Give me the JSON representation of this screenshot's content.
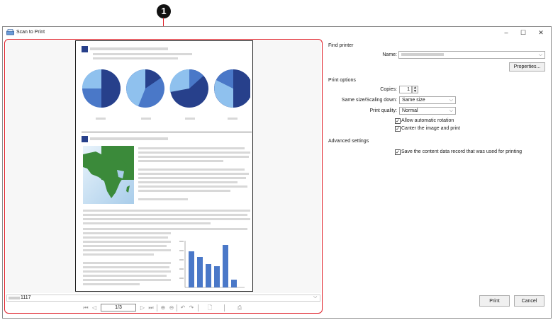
{
  "callout": {
    "number": "1"
  },
  "window": {
    "title": "Scan to Print",
    "controls": {
      "minimize": "–",
      "maximize": "☐",
      "close": "✕"
    }
  },
  "preview": {
    "file_name": "1117",
    "page_indicator": "1/3"
  },
  "find_printer": {
    "section_label": "Find printer",
    "name_label": "Name:",
    "name_value": "",
    "properties_button": "Properties..."
  },
  "print_options": {
    "section_label": "Print options",
    "copies_label": "Copies:",
    "copies_value": "1",
    "scaling_label": "Same size/Scaling down:",
    "scaling_value": "Same size",
    "quality_label": "Print quality:",
    "quality_value": "Normal",
    "allow_rotation": {
      "label": "Allow automatic rotation",
      "checked": true
    },
    "center_image": {
      "label": "Canter the image and print",
      "checked": true
    }
  },
  "advanced": {
    "section_label": "Advanced settings",
    "save_record": {
      "label": "Save the content data record that was used for printing",
      "checked": true
    }
  },
  "buttons": {
    "print": "Print",
    "cancel": "Cancel"
  },
  "colors": {
    "accent_red": "#e0222b",
    "chart_dark": "#27408b",
    "chart_mid": "#4a78c8",
    "chart_light": "#8fc1ee",
    "map_green": "#3b8a3a"
  }
}
